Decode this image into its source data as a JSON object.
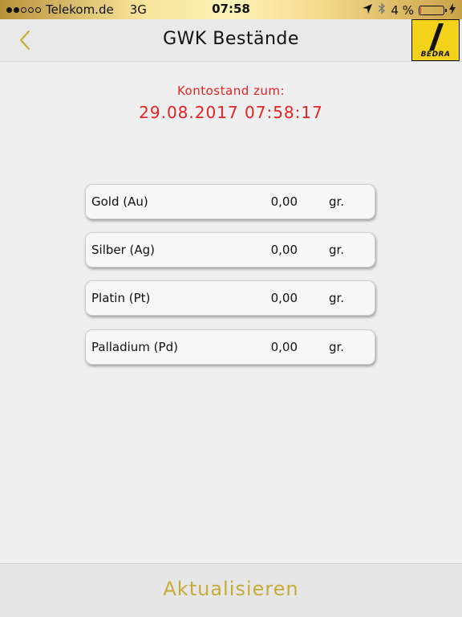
{
  "status_bar": {
    "carrier": "Telekom.de",
    "network": "3G",
    "time": "07:58",
    "battery": "4 %",
    "battery_level": 0.04
  },
  "nav": {
    "title": "GWK Bestände",
    "logo_text": "BEDRA"
  },
  "balance": {
    "label": "Kontostand zum:",
    "datetime": "29.08.2017 07:58:17"
  },
  "holdings": [
    {
      "name": "Gold (Au)",
      "amount": "0,00",
      "unit": "gr."
    },
    {
      "name": "Silber (Ag)",
      "amount": "0,00",
      "unit": "gr."
    },
    {
      "name": "Platin (Pt)",
      "amount": "0,00",
      "unit": "gr."
    },
    {
      "name": "Palladium (Pd)",
      "amount": "0,00",
      "unit": "gr."
    }
  ],
  "footer": {
    "refresh_label": "Aktualisieren"
  },
  "colors": {
    "accent_gold": "#c6ac36",
    "balance_red": "#e32222",
    "logo_yellow": "#f2d21b"
  }
}
